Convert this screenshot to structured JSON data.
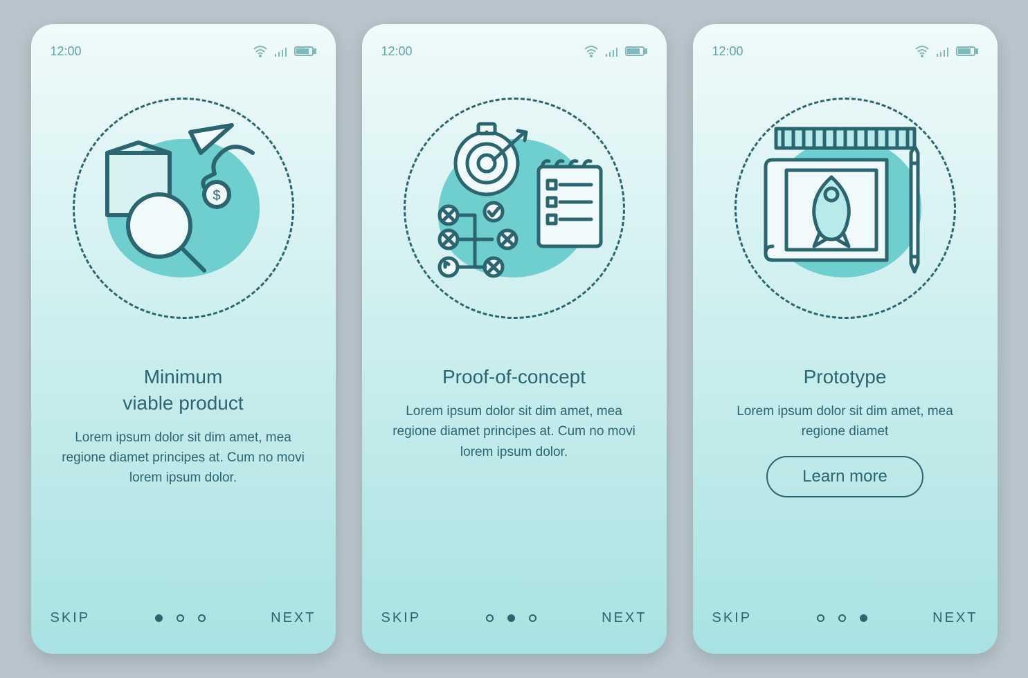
{
  "status": {
    "time": "12:00"
  },
  "nav": {
    "skip": "SKIP",
    "next": "NEXT",
    "learn_more": "Learn more"
  },
  "screens": [
    {
      "title": "Minimum\nviable product",
      "body": "Lorem ipsum dolor sit dim amet, mea regione diamet principes at. Cum no movi lorem ipsum dolor.",
      "active_dot": 0
    },
    {
      "title": "Proof-of-concept",
      "body": "Lorem ipsum dolor sit dim amet, mea regione diamet principes at. Cum no movi lorem ipsum dolor.",
      "active_dot": 1
    },
    {
      "title": "Prototype",
      "body": "Lorem ipsum dolor sit dim amet, mea regione diamet",
      "active_dot": 2,
      "cta": true
    }
  ]
}
